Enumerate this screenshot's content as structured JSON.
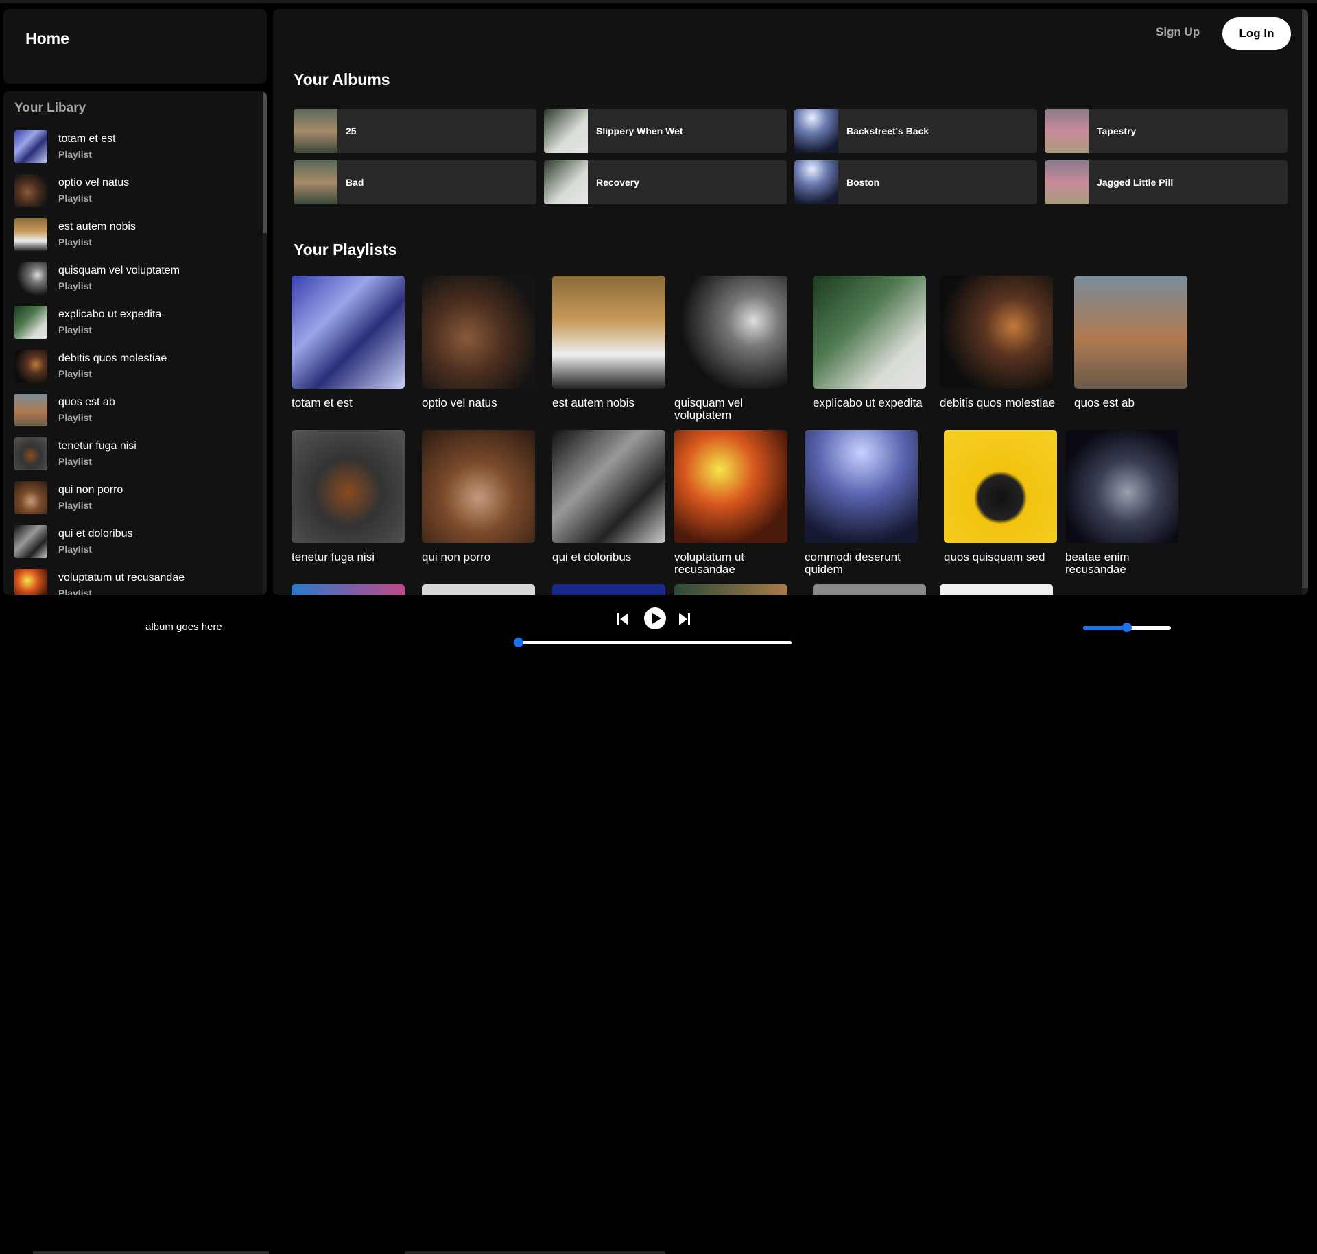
{
  "sidebar": {
    "home_label": "Home",
    "library_title": "Your Libary",
    "items": [
      {
        "name": "totam et est",
        "type": "Playlist",
        "art": "art-0"
      },
      {
        "name": "optio vel natus",
        "type": "Playlist",
        "art": "art-1"
      },
      {
        "name": "est autem nobis",
        "type": "Playlist",
        "art": "art-2"
      },
      {
        "name": "quisquam vel voluptatem",
        "type": "Playlist",
        "art": "art-3"
      },
      {
        "name": "explicabo ut expedita",
        "type": "Playlist",
        "art": "art-4"
      },
      {
        "name": "debitis quos molestiae",
        "type": "Playlist",
        "art": "art-5"
      },
      {
        "name": "quos est ab",
        "type": "Playlist",
        "art": "art-6"
      },
      {
        "name": "tenetur fuga nisi",
        "type": "Playlist",
        "art": "art-7"
      },
      {
        "name": "qui non porro",
        "type": "Playlist",
        "art": "art-8"
      },
      {
        "name": "qui et doloribus",
        "type": "Playlist",
        "art": "art-9"
      },
      {
        "name": "voluptatum ut recusandae",
        "type": "Playlist",
        "art": "art-10"
      }
    ]
  },
  "header": {
    "signup_label": "Sign Up",
    "login_label": "Log In"
  },
  "albums": {
    "title": "Your Albums",
    "items": [
      {
        "name": "25",
        "art": "art-album-a"
      },
      {
        "name": "Slippery When Wet",
        "art": "art-album-b"
      },
      {
        "name": "Backstreet's Back",
        "art": "art-album-c"
      },
      {
        "name": "Tapestry",
        "art": "art-album-d"
      },
      {
        "name": "Bad",
        "art": "art-album-a"
      },
      {
        "name": "Recovery",
        "art": "art-album-b"
      },
      {
        "name": "Boston",
        "art": "art-album-c"
      },
      {
        "name": "Jagged Little Pill",
        "art": "art-album-d"
      }
    ]
  },
  "playlists": {
    "title": "Your Playlists",
    "items": [
      {
        "name": "totam et est",
        "art": "art-0"
      },
      {
        "name": "optio vel natus",
        "art": "art-1"
      },
      {
        "name": "est autem nobis",
        "art": "art-2"
      },
      {
        "name": "quisquam vel voluptatem",
        "art": "art-3"
      },
      {
        "name": "explicabo ut expedita",
        "art": "art-4"
      },
      {
        "name": "debitis quos molestiae",
        "art": "art-5"
      },
      {
        "name": "quos est ab",
        "art": "art-6"
      },
      {
        "name": "tenetur fuga nisi",
        "art": "art-7"
      },
      {
        "name": "qui non porro",
        "art": "art-8"
      },
      {
        "name": "qui et doloribus",
        "art": "art-9"
      },
      {
        "name": "voluptatum ut recusandae",
        "art": "art-10"
      },
      {
        "name": "commodi deserunt quidem",
        "art": "art-11"
      },
      {
        "name": "quos quisquam sed",
        "art": "art-12"
      },
      {
        "name": "beatae enim recusandae",
        "art": "art-13"
      }
    ],
    "peek_art": [
      "art-peek-0",
      "art-peek-1",
      "art-peek-2",
      "art-peek-3",
      "art-peek-4",
      "art-peek-5"
    ]
  },
  "player": {
    "album_text": "album goes here",
    "controls": {
      "prev_icon": "skip-back-icon",
      "play_icon": "play-icon",
      "next_icon": "skip-forward-icon"
    },
    "progress_fraction": 0.0,
    "volume_fraction": 0.5
  },
  "colors": {
    "accent": "#1a73e8",
    "panel": "#121212",
    "card": "#282828",
    "muted": "#a7a7a7"
  }
}
